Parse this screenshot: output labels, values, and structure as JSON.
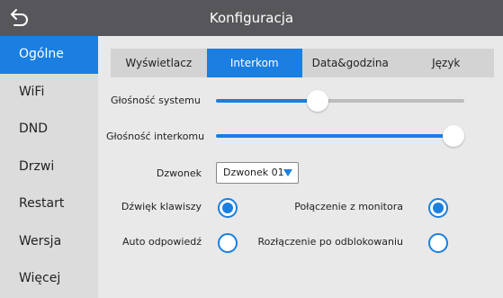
{
  "header": {
    "title": "Konfiguracja",
    "back_icon": "back-arrow-icon"
  },
  "sidebar": {
    "items": [
      {
        "label": "Ogólne",
        "active": true
      },
      {
        "label": "WiFi",
        "active": false
      },
      {
        "label": "DND",
        "active": false
      },
      {
        "label": "Drzwi",
        "active": false
      },
      {
        "label": "Restart",
        "active": false
      },
      {
        "label": "Wersja",
        "active": false
      },
      {
        "label": "Więcej",
        "active": false
      }
    ]
  },
  "tabs": [
    {
      "label": "Wyświetlacz",
      "active": false
    },
    {
      "label": "Interkom",
      "active": true
    },
    {
      "label": "Data&godzina",
      "active": false
    },
    {
      "label": "Język",
      "active": false
    }
  ],
  "settings": {
    "system_volume": {
      "label": "Głośność systemu",
      "level": 0.41
    },
    "intercom_volume": {
      "label": "Głośność interkomu",
      "level": 1.0
    },
    "ringtone": {
      "label": "Dzwonek",
      "value": "Dzwonek 01"
    },
    "key_sound": {
      "label": "Dźwięk klawiszy",
      "checked": true
    },
    "monitor_connection": {
      "label": "Połączenie z monitora",
      "checked": true
    },
    "auto_answer": {
      "label": "Auto odpowiedź",
      "checked": false
    },
    "disconnect_after_unlock": {
      "label": "Rozłączenie po odblokowaniu",
      "checked": false
    }
  },
  "colors": {
    "accent": "#1a7fe1",
    "titlebar": "#57575b",
    "sidebar_bg": "#dcdcdc",
    "content_bg": "#e9e9e9"
  }
}
